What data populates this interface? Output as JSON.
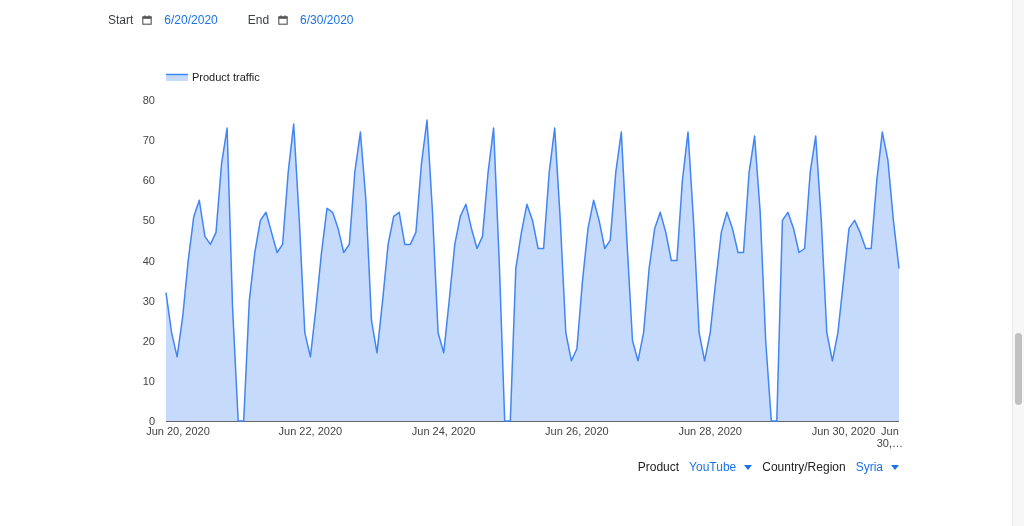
{
  "filters": [
    {
      "label": "Start",
      "value": "6/20/2020"
    },
    {
      "label": "End",
      "value": "6/30/2020"
    }
  ],
  "chart": {
    "chart_data": {
      "type": "area",
      "categories": [
        null,
        null,
        "Jun 20, 2020",
        null,
        null,
        null,
        null,
        null,
        null,
        null,
        null,
        null,
        null,
        null,
        null,
        null,
        null,
        null,
        null,
        null,
        null,
        null,
        null,
        null,
        null,
        null,
        "Jun 22, 2020",
        null,
        null,
        null,
        null,
        null,
        null,
        null,
        null,
        null,
        null,
        null,
        null,
        null,
        null,
        null,
        null,
        null,
        null,
        null,
        null,
        null,
        null,
        null,
        "Jun 24, 2020",
        null,
        null,
        null,
        null,
        null,
        null,
        null,
        null,
        null,
        null,
        null,
        null,
        null,
        null,
        null,
        null,
        null,
        null,
        null,
        null,
        null,
        null,
        null,
        "Jun 26, 2020",
        null,
        null,
        null,
        null,
        null,
        null,
        null,
        null,
        null,
        null,
        null,
        null,
        null,
        null,
        null,
        null,
        null,
        null,
        null,
        null,
        null,
        null,
        null,
        "Jun 28, 2020",
        null,
        null,
        null,
        null,
        null,
        null,
        null,
        null,
        null,
        null,
        null,
        null,
        null,
        null,
        null,
        null,
        null,
        null,
        null,
        null,
        null,
        null,
        null,
        "Jun 30, 2020",
        null,
        null,
        null,
        null,
        null,
        null,
        null,
        "Jun 30,…",
        null,
        null
      ],
      "series": [
        {
          "name": "Product traffic",
          "color": "#4285f4",
          "values": [
            32,
            22,
            16,
            26,
            40,
            51,
            55,
            46,
            44,
            47,
            64,
            73,
            28,
            0,
            0,
            30,
            42,
            50,
            52,
            47,
            42,
            44,
            62,
            74,
            50,
            22,
            16,
            28,
            42,
            53,
            52,
            48,
            42,
            44,
            62,
            72,
            55,
            25,
            17,
            30,
            44,
            51,
            52,
            44,
            44,
            47,
            64,
            75,
            52,
            22,
            17,
            30,
            44,
            51,
            54,
            48,
            43,
            46,
            62,
            73,
            40,
            0,
            0,
            38,
            47,
            54,
            50,
            43,
            43,
            62,
            73,
            50,
            22,
            15,
            18,
            35,
            48,
            55,
            50,
            43,
            45,
            62,
            72,
            45,
            20,
            15,
            22,
            38,
            48,
            52,
            47,
            40,
            40,
            60,
            72,
            50,
            22,
            15,
            22,
            35,
            47,
            52,
            48,
            42,
            42,
            62,
            71,
            52,
            20,
            0,
            0,
            50,
            52,
            48,
            42,
            43,
            62,
            71,
            50,
            22,
            15,
            22,
            35,
            48,
            50,
            47,
            43,
            43,
            60,
            72,
            65,
            50,
            38
          ]
        }
      ],
      "ylim": [
        0,
        80
      ],
      "yticks": [
        0,
        10,
        20,
        30,
        40,
        50,
        60,
        70,
        80
      ]
    }
  },
  "selectors": [
    {
      "label": "Product",
      "value": "YouTube"
    },
    {
      "label": "Country/Region",
      "value": "Syria"
    }
  ]
}
